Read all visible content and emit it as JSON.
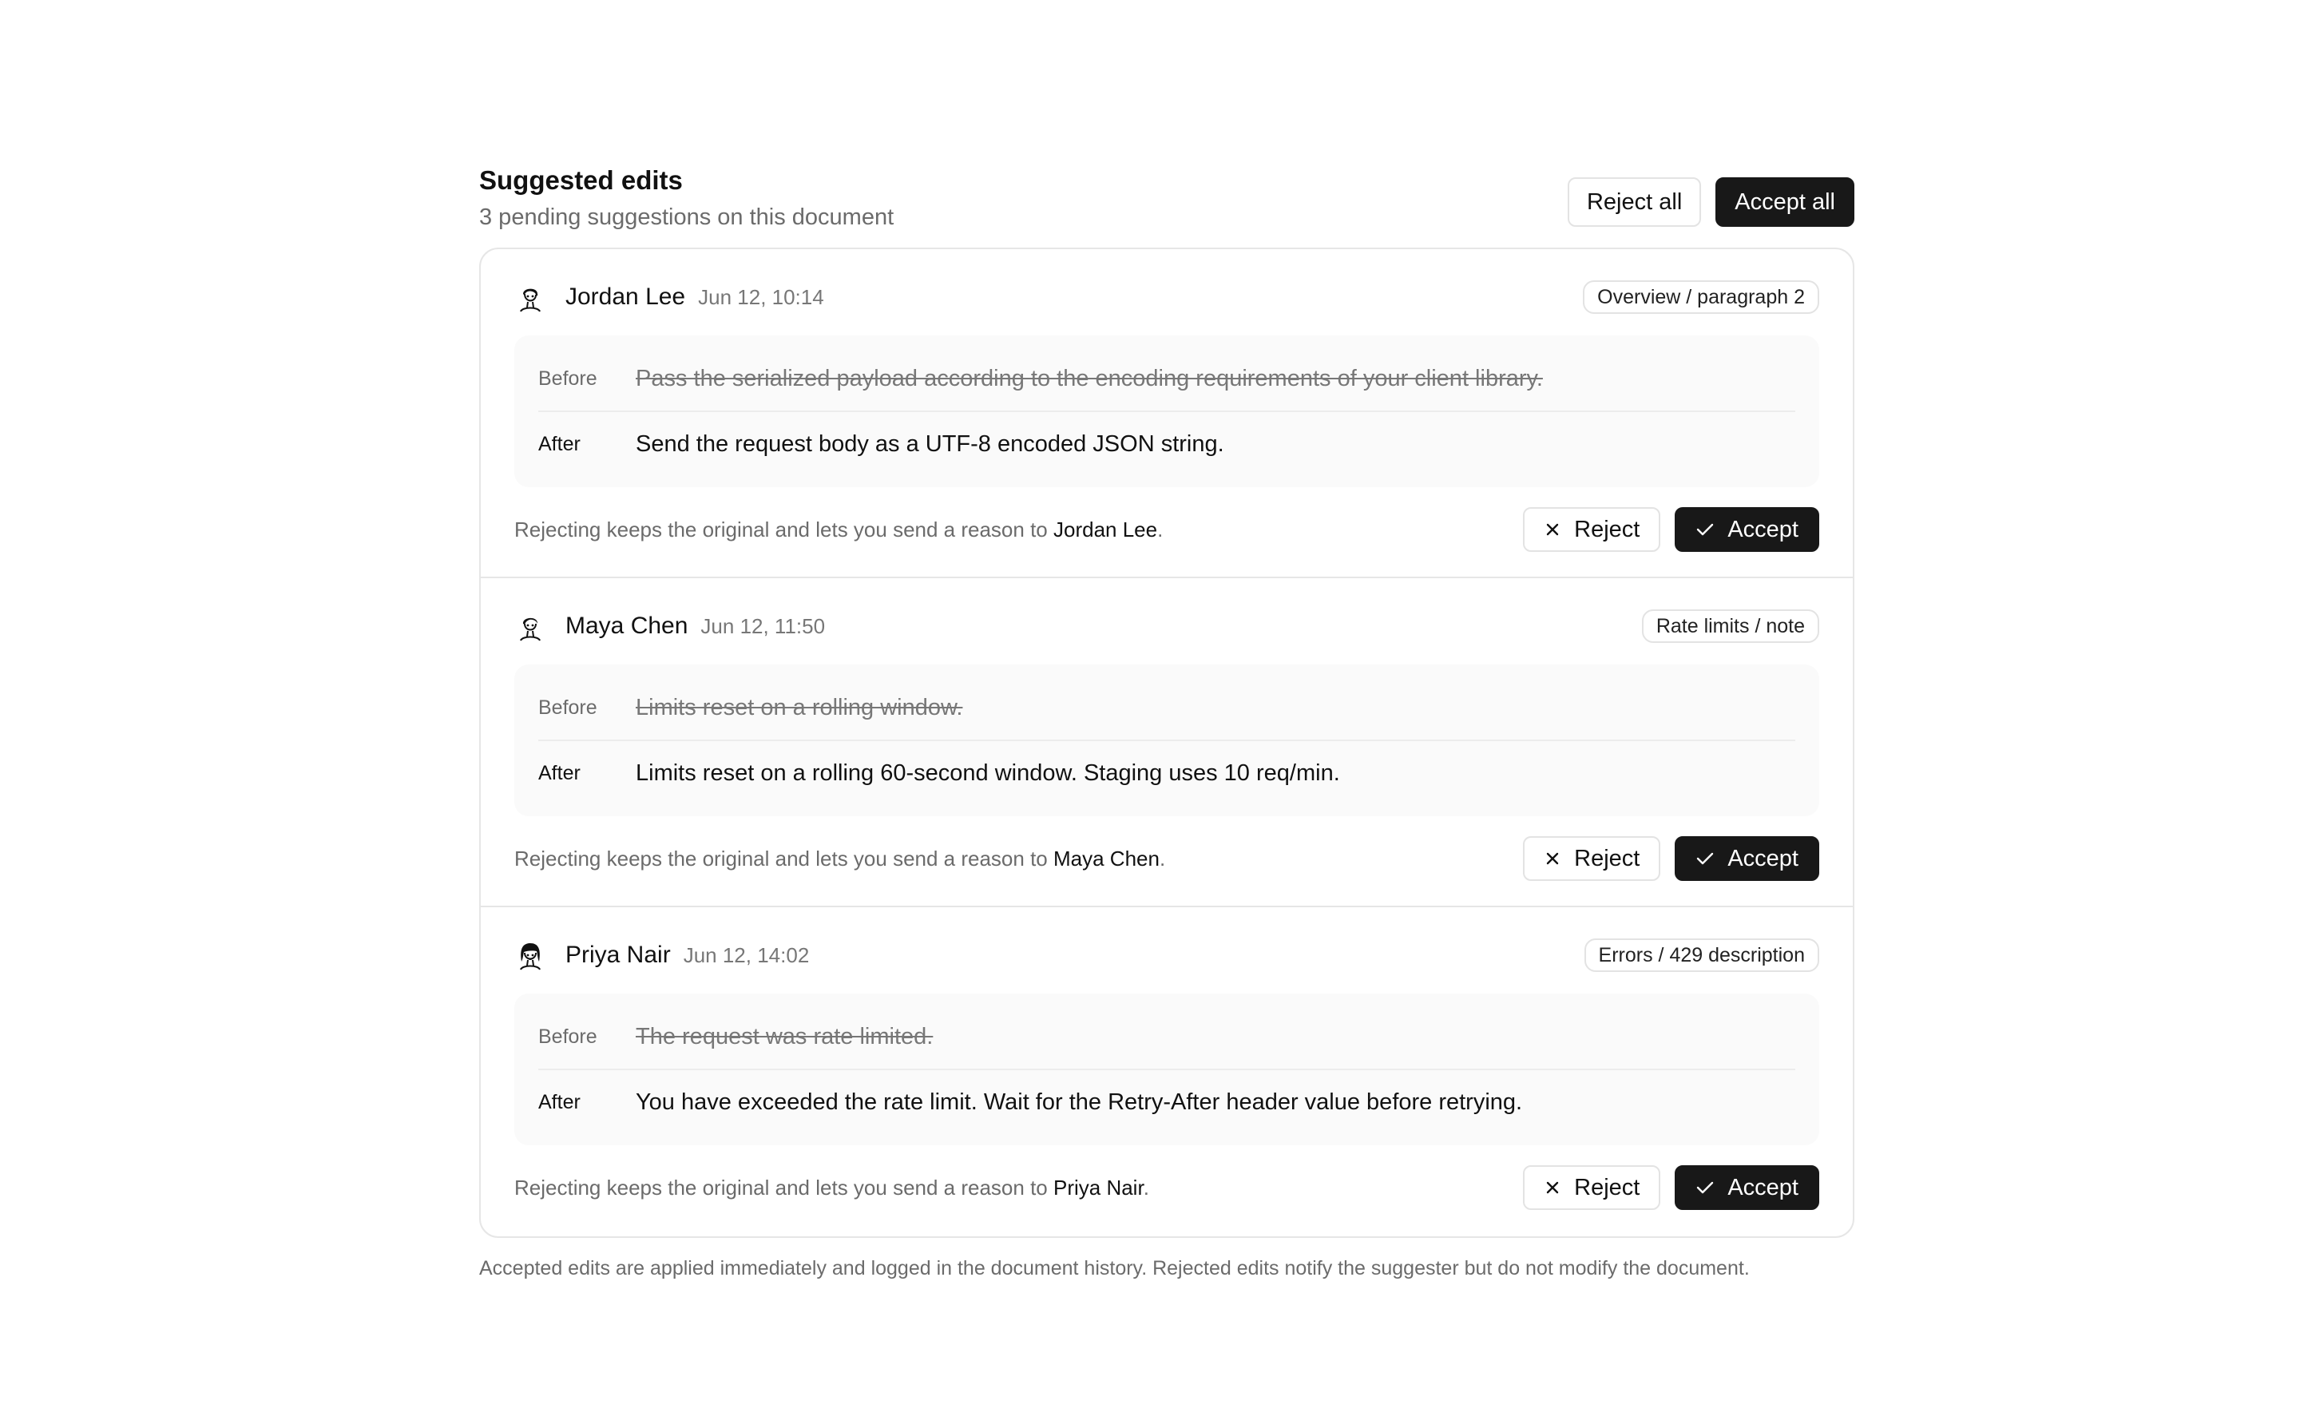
{
  "header": {
    "title": "Suggested edits",
    "subtitle": "3 pending suggestions on this document",
    "reject_all_label": "Reject all",
    "accept_all_label": "Accept all"
  },
  "suggestions": [
    {
      "author": "Jordan Lee",
      "time": "Jun 12, 10:14",
      "location": "Overview / paragraph 2",
      "before_label": "Before",
      "before_text": "Pass the serialized payload according to the encoding requirements of your client library.",
      "after_label": "After",
      "after_text": "Send the request body as a UTF-8 encoded JSON string.",
      "note_prefix": "Rejecting keeps the original and lets you send a reason to ",
      "note_name": "Jordan Lee",
      "note_suffix": ".",
      "reject_label": "Reject",
      "accept_label": "Accept"
    },
    {
      "author": "Maya Chen",
      "time": "Jun 12, 11:50",
      "location": "Rate limits / note",
      "before_label": "Before",
      "before_text": "Limits reset on a rolling window.",
      "after_label": "After",
      "after_text": "Limits reset on a rolling 60-second window. Staging uses 10 req/min.",
      "note_prefix": "Rejecting keeps the original and lets you send a reason to ",
      "note_name": "Maya Chen",
      "note_suffix": ".",
      "reject_label": "Reject",
      "accept_label": "Accept"
    },
    {
      "author": "Priya Nair",
      "time": "Jun 12, 14:02",
      "location": "Errors / 429 description",
      "before_label": "Before",
      "before_text": "The request was rate limited.",
      "after_label": "After",
      "after_text": "You have exceeded the rate limit. Wait for the Retry-After header value before retrying.",
      "note_prefix": "Rejecting keeps the original and lets you send a reason to ",
      "note_name": "Priya Nair",
      "note_suffix": ".",
      "reject_label": "Reject",
      "accept_label": "Accept"
    }
  ],
  "footer": {
    "text": "Accepted edits are applied immediately and logged in the document history. Rejected edits notify the suggester but do not modify the document."
  },
  "icons": {
    "reject": "close-icon",
    "accept": "check-icon",
    "avatar": "person-avatar-icon"
  },
  "colors": {
    "primary_button": "#181818",
    "border": "#e6e6e6",
    "muted_text": "#6b6b6b"
  }
}
